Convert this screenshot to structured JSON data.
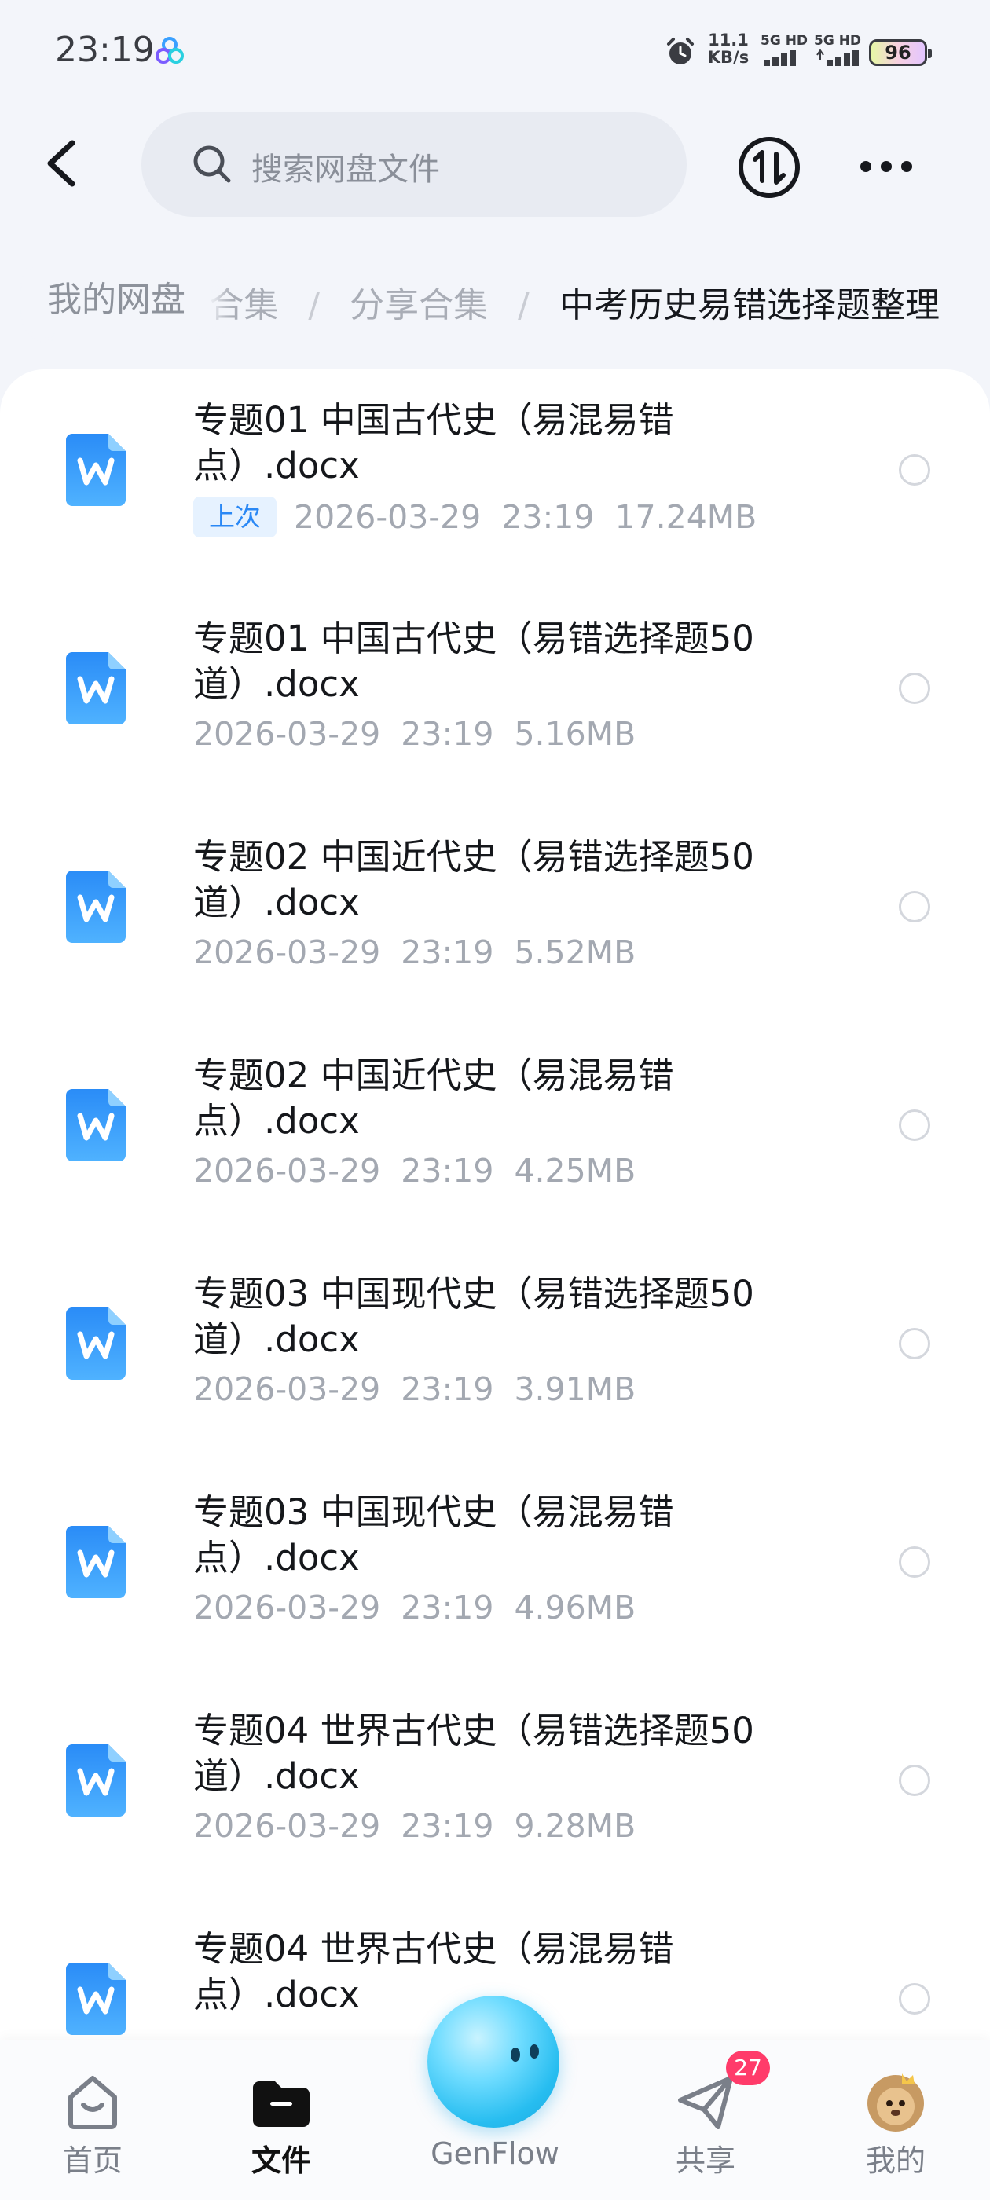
{
  "status_bar": {
    "time": "23:19",
    "net_speed_value": "11.1",
    "net_speed_unit": "KB/s",
    "sim1_label": "5G HD",
    "sim2_label": "5G HD",
    "battery": "96"
  },
  "search": {
    "placeholder": "搜索网盘文件"
  },
  "breadcrumb": {
    "root": "我的网盘",
    "hidden_item": "合集",
    "item": "分享合集",
    "current": "中考历史易错选择题整理",
    "separator": "/"
  },
  "files": [
    {
      "name": "专题01 中国古代史（易混易错点）.docx",
      "badge": "上次",
      "date": "2026-03-29",
      "time": "23:19",
      "size": "17.24MB"
    },
    {
      "name": "专题01 中国古代史（易错选择题50道）.docx",
      "date": "2026-03-29",
      "time": "23:19",
      "size": "5.16MB"
    },
    {
      "name": "专题02 中国近代史（易错选择题50道）.docx",
      "date": "2026-03-29",
      "time": "23:19",
      "size": "5.52MB"
    },
    {
      "name": "专题02 中国近代史（易混易错点）.docx",
      "date": "2026-03-29",
      "time": "23:19",
      "size": "4.25MB"
    },
    {
      "name": "专题03 中国现代史（易错选择题50道）.docx",
      "date": "2026-03-29",
      "time": "23:19",
      "size": "3.91MB"
    },
    {
      "name": "专题03 中国现代史（易混易错点）.docx",
      "date": "2026-03-29",
      "time": "23:19",
      "size": "4.96MB"
    },
    {
      "name": "专题04 世界古代史（易错选择题50道）.docx",
      "date": "2026-03-29",
      "time": "23:19",
      "size": "9.28MB"
    },
    {
      "name": "专题04 世界古代史（易混易错点）.docx"
    }
  ],
  "file_icon": "word-document-icon",
  "nav": {
    "home": "首页",
    "files": "文件",
    "genflow": "GenFlow",
    "share": "共享",
    "share_badge": "27",
    "me": "我的"
  },
  "colors": {
    "accent": "#2a88f5",
    "badge_red": "#ff3b6a",
    "background": "#f3f5fa"
  }
}
